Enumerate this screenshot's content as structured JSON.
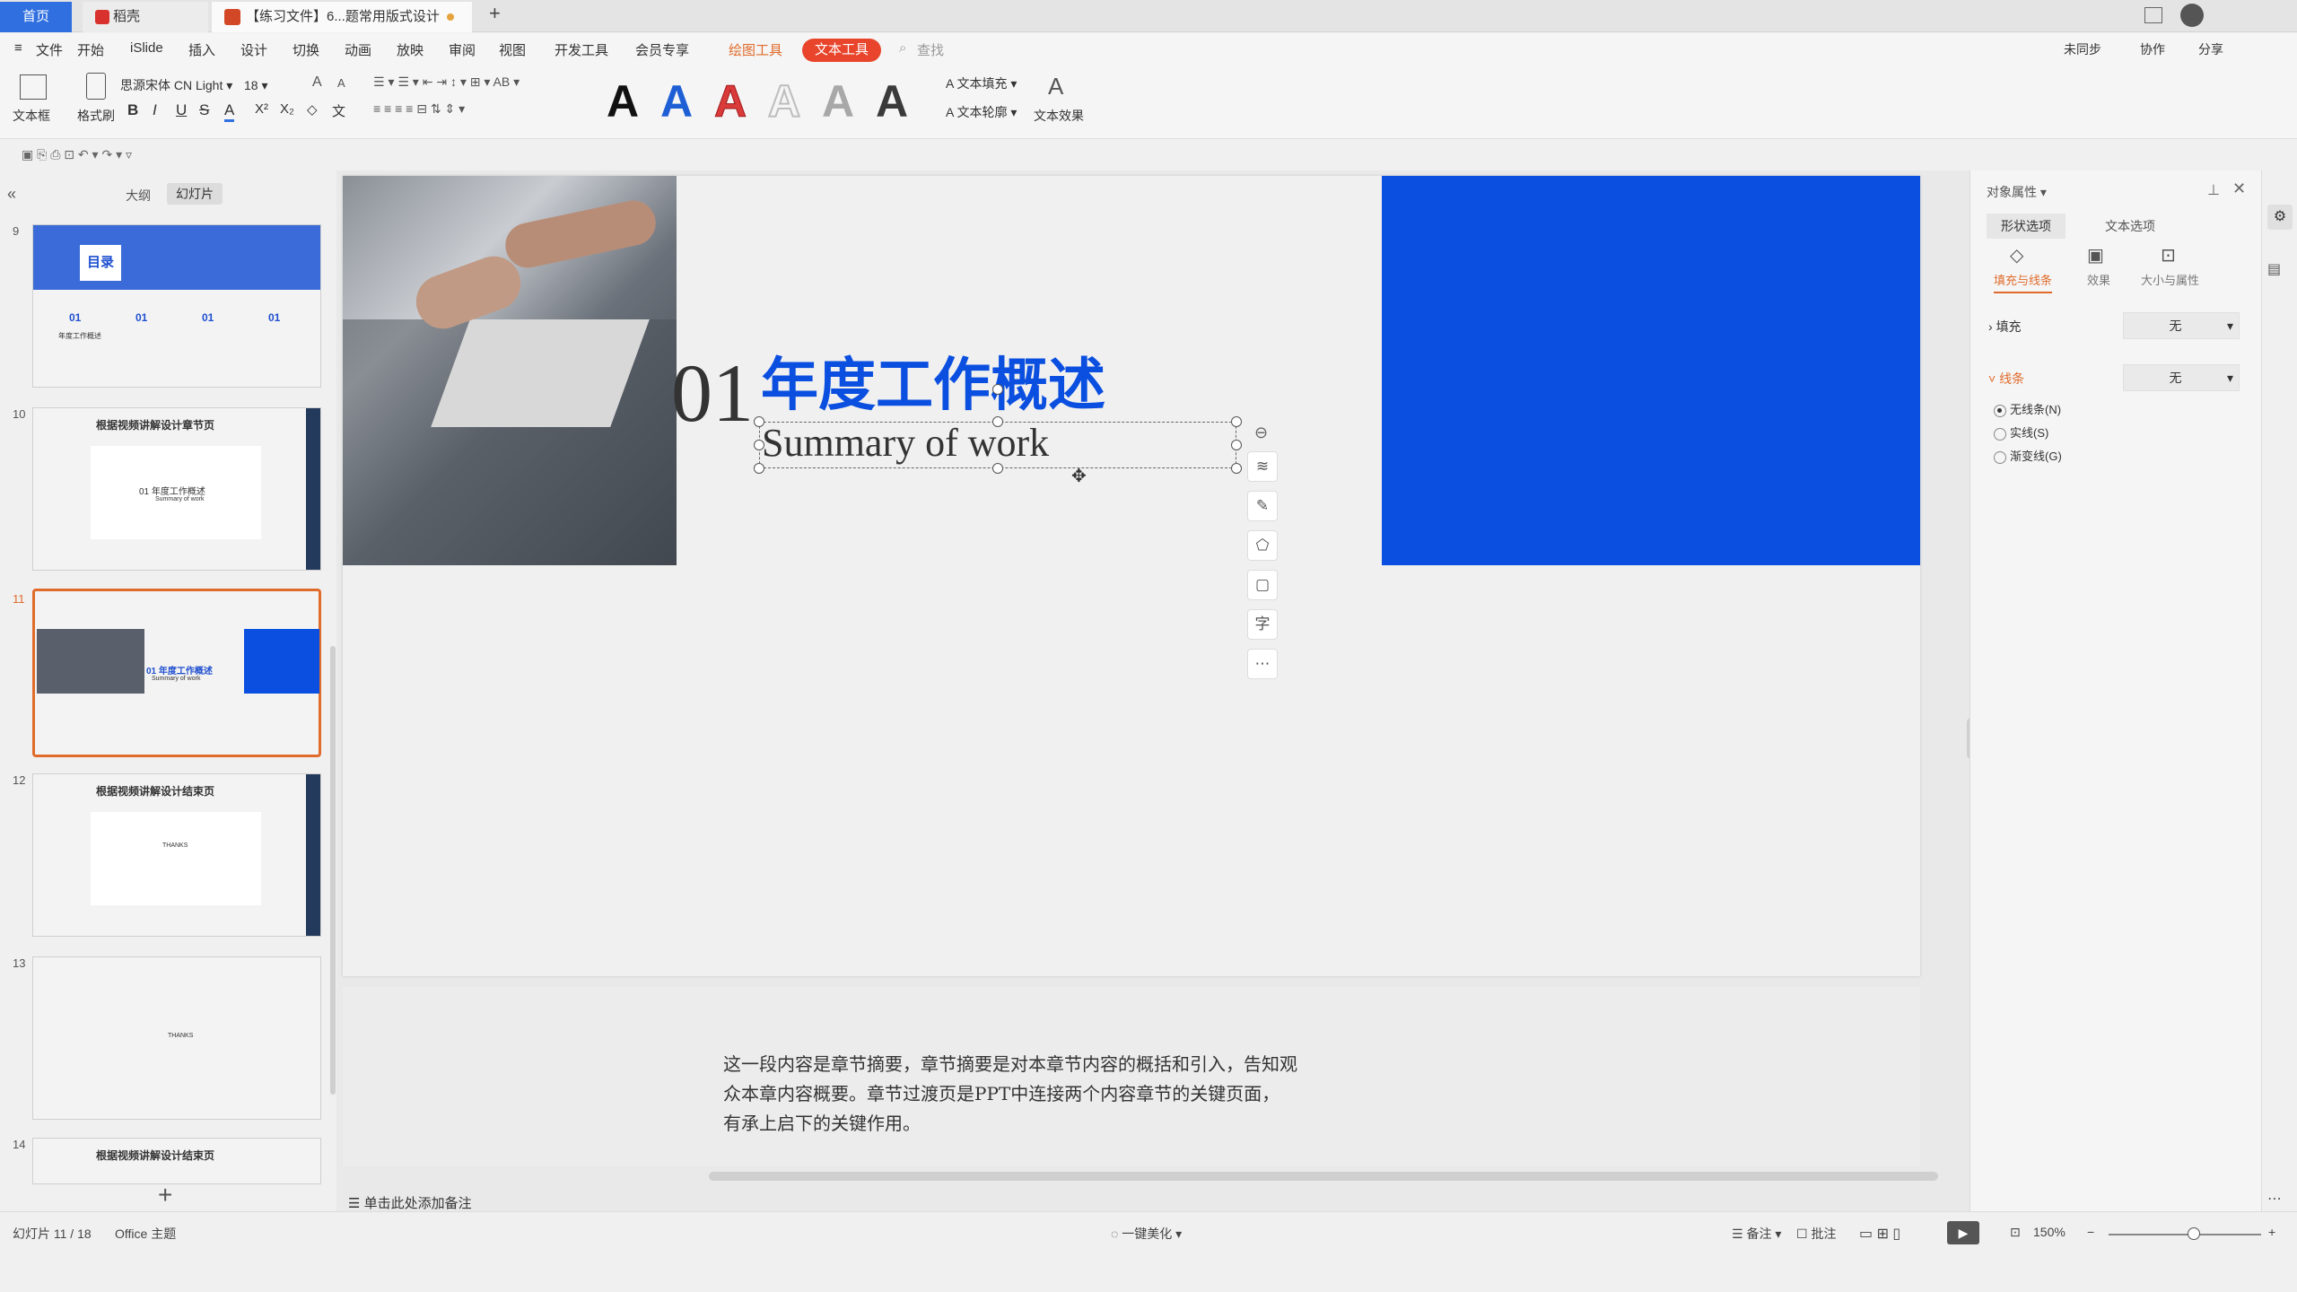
{
  "titlebar": {
    "tabs": [
      {
        "label": "首页"
      },
      {
        "label": "稻壳"
      },
      {
        "label": "【练习文件】6...题常用版式设计"
      }
    ],
    "add_tab": "+"
  },
  "menubar": {
    "file": "文件",
    "items": [
      "开始",
      "iSlide",
      "插入",
      "设计",
      "切换",
      "动画",
      "放映",
      "审阅",
      "视图",
      "开发工具",
      "会员专享"
    ],
    "drawing_tool": "绘图工具",
    "text_tool": "文本工具",
    "search": "查找",
    "right_items": [
      "未同步",
      "协作",
      "分享"
    ]
  },
  "ribbon": {
    "textbox": "文本框",
    "format_painter": "格式刷",
    "font_name": "思源宋体 CN Light",
    "font_size": "18",
    "bold": "B",
    "italic": "I",
    "underline": "U",
    "strike": "S",
    "text_fill": "文本填充",
    "text_outline": "文本轮廓",
    "text_effect": "文本效果",
    "wordart_colors": [
      "#111111",
      "#1f5fd6",
      "#d93a3a",
      "#bdbdbd",
      "#a8a8a8",
      "#3a3a3a"
    ]
  },
  "outline_tabs": {
    "outline": "大纲",
    "slides": "幻灯片"
  },
  "thumbnails": [
    {
      "num": "9",
      "title": "目录",
      "items": [
        "01",
        "01",
        "01",
        "01"
      ],
      "caption": "年度工作概述"
    },
    {
      "num": "10",
      "title": "根据视频讲解设计章节页",
      "sub": "01 年度工作概述",
      "sub2": "Summary of work"
    },
    {
      "num": "11",
      "title": "01 年度工作概述",
      "sub": "Summary of work"
    },
    {
      "num": "12",
      "title": "根据视频讲解设计结束页",
      "sub": "THANKS"
    },
    {
      "num": "13",
      "sub": "THANKS"
    },
    {
      "num": "14",
      "title": "根据视频讲解设计结束页"
    }
  ],
  "slide": {
    "number": "01",
    "title": "年度工作概述",
    "subtitle": "Summary of work",
    "blue": "#0a4fe0"
  },
  "notes": {
    "paragraph": "这一段内容是章节摘要，章节摘要是对本章节内容的概括和引入，告知观众本章内容概要。章节过渡页是PPT中连接两个内容章节的关键页面，有承上启下的关键作用。",
    "add_notes": "单击此处添加备注"
  },
  "rightpanel": {
    "title": "对象属性",
    "tab_shape": "形状选项",
    "tab_text": "文本选项",
    "sub_fill_line": "填充与线条",
    "sub_effect": "效果",
    "sub_size": "大小与属性",
    "fill_label": "填充",
    "fill_value": "无",
    "line_label": "线条",
    "line_value": "无",
    "radio_none": "无线条(N)",
    "radio_solid": "实线(S)",
    "radio_gradient": "渐变线(G)"
  },
  "statusbar": {
    "slide_info": "幻灯片 11 / 18",
    "theme": "Office 主题",
    "beautify": "一键美化",
    "notes": "备注",
    "comments": "批注",
    "zoom": "150%"
  }
}
